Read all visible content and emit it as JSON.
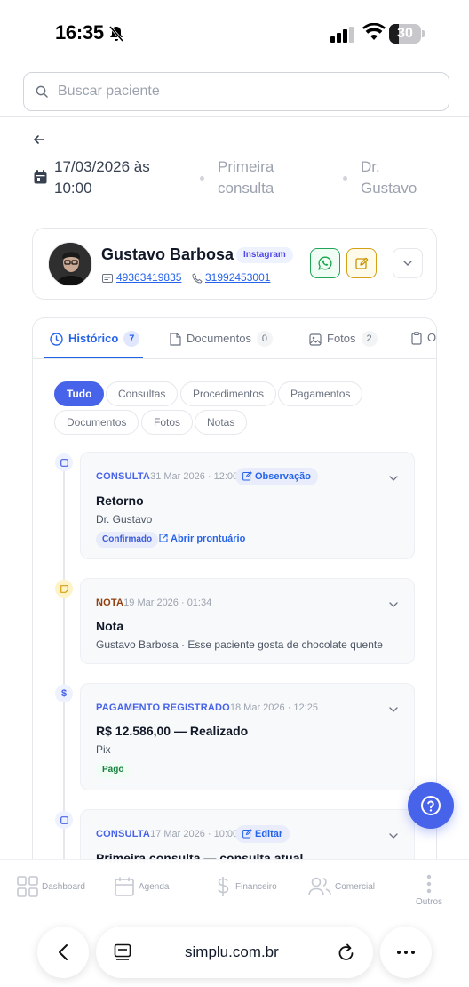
{
  "status_bar": {
    "time": "16:35",
    "battery": "30",
    "battery_level": 0.3
  },
  "search": {
    "placeholder": "Buscar paciente"
  },
  "appointment": {
    "date_line1": "17/03/2026 às",
    "date_line2": "10:00",
    "type_line1": "Primeira",
    "type_line2": "consulta",
    "doctor_line1": "Dr.",
    "doctor_line2": "Gustavo"
  },
  "patient": {
    "name": "Gustavo Barbosa",
    "source_tag": "Instagram",
    "document": "49363419835",
    "phone": "31992453001"
  },
  "tabs": [
    {
      "label": "Histórico",
      "count": "7"
    },
    {
      "label": "Documentos",
      "count": "0"
    },
    {
      "label": "Fotos",
      "count": "2"
    },
    {
      "label": "O"
    }
  ],
  "filters": [
    "Tudo",
    "Consultas",
    "Procedimentos",
    "Pagamentos",
    "Documentos",
    "Fotos",
    "Notas"
  ],
  "timeline": [
    {
      "type": "CONSULTA",
      "date": "31 Mar 2026 · 12:00",
      "action": "Observação",
      "title": "Retorno",
      "subtitle": "Dr. Gustavo",
      "status": "Confirmado",
      "link": "Abrir prontuário"
    },
    {
      "type": "NOTA",
      "date": "19 Mar 2026 · 01:34",
      "title": "Nota",
      "subtitle": "Gustavo Barbosa · Esse paciente gosta de chocolate quente"
    },
    {
      "type": "PAGAMENTO REGISTRADO",
      "date": "18 Mar 2026 · 12:25",
      "title": "R$ 12.586,00 — Realizado",
      "subtitle": "Pix",
      "status": "Pago"
    },
    {
      "type": "CONSULTA",
      "date": "17 Mar 2026 · 10:00",
      "action": "Editar",
      "title": "Primeira consulta — consulta atual"
    }
  ],
  "bottom_nav": [
    "Dashboard",
    "Agenda",
    "Financeiro",
    "Comercial",
    "Outros"
  ],
  "browser": {
    "url": "simplu.com.br"
  },
  "colors": {
    "accent": "#4763ea",
    "link": "#2563eb",
    "success": "#16a34a",
    "warning": "#d4a017",
    "note": "#92400e"
  }
}
